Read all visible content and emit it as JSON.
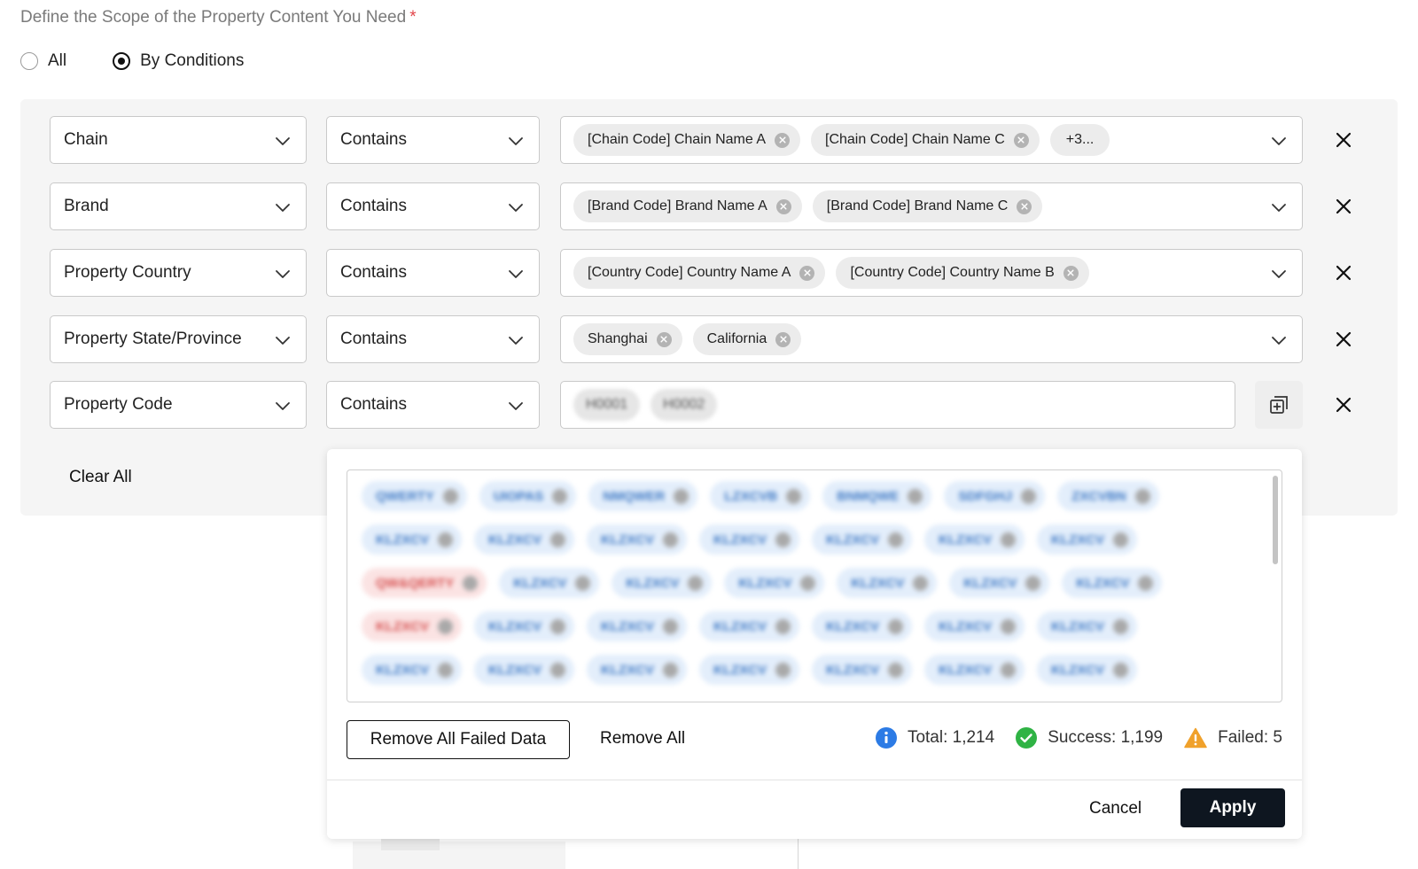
{
  "scope": {
    "title": "Define the Scope of the Property Content You Need",
    "required_mark": "*",
    "options": [
      {
        "label": "All",
        "selected": false
      },
      {
        "label": "By Conditions",
        "selected": true
      }
    ]
  },
  "conditions": [
    {
      "field": "Chain",
      "operator": "Contains",
      "values": [
        "[Chain Code] Chain Name A",
        "[Chain Code] Chain Name C"
      ],
      "more": "+3..."
    },
    {
      "field": "Brand",
      "operator": "Contains",
      "values": [
        "[Brand Code] Brand Name A",
        "[Brand Code] Brand Name C"
      ]
    },
    {
      "field": "Property Country",
      "operator": "Contains",
      "values": [
        "[Country Code] Country Name A",
        "[Country Code] Country Name B"
      ]
    },
    {
      "field": "Property State/Province",
      "operator": "Contains",
      "values": [
        "Shanghai",
        "California"
      ]
    },
    {
      "field": "Property Code",
      "operator": "Contains",
      "values": [
        "H0001",
        "H0002"
      ]
    }
  ],
  "clear_all_label": "Clear All",
  "popup": {
    "chip_rows": [
      [
        {
          "text": "QWERTY",
          "status": "ok"
        },
        {
          "text": "UIOPAS",
          "status": "ok"
        },
        {
          "text": "NMQWER",
          "status": "ok"
        },
        {
          "text": "LZXCVB",
          "status": "ok"
        },
        {
          "text": "BNMQWE",
          "status": "ok"
        },
        {
          "text": "SDFGHJ",
          "status": "ok"
        },
        {
          "text": "ZXCVBN",
          "status": "ok"
        }
      ],
      [
        {
          "text": "KLZXCV",
          "status": "ok"
        },
        {
          "text": "KLZXCV",
          "status": "ok"
        },
        {
          "text": "KLZXCV",
          "status": "ok"
        },
        {
          "text": "KLZXCV",
          "status": "ok"
        },
        {
          "text": "KLZXCV",
          "status": "ok"
        },
        {
          "text": "KLZXCV",
          "status": "ok"
        },
        {
          "text": "KLZXCV",
          "status": "ok"
        }
      ],
      [
        {
          "text": "QW&QERTY",
          "status": "fail"
        },
        {
          "text": "KLZXCV",
          "status": "ok"
        },
        {
          "text": "KLZXCV",
          "status": "ok"
        },
        {
          "text": "KLZXCV",
          "status": "ok"
        },
        {
          "text": "KLZXCV",
          "status": "ok"
        },
        {
          "text": "KLZXCV",
          "status": "ok"
        },
        {
          "text": "KLZXCV",
          "status": "ok"
        }
      ],
      [
        {
          "text": "KLZXCV",
          "status": "fail"
        },
        {
          "text": "KLZXCV",
          "status": "ok"
        },
        {
          "text": "KLZXCV",
          "status": "ok"
        },
        {
          "text": "KLZXCV",
          "status": "ok"
        },
        {
          "text": "KLZXCV",
          "status": "ok"
        },
        {
          "text": "KLZXCV",
          "status": "ok"
        },
        {
          "text": "KLZXCV",
          "status": "ok"
        }
      ],
      [
        {
          "text": "KLZXCV",
          "status": "ok"
        },
        {
          "text": "KLZXCV",
          "status": "ok"
        },
        {
          "text": "KLZXCV",
          "status": "ok"
        },
        {
          "text": "KLZXCV",
          "status": "ok"
        },
        {
          "text": "KLZXCV",
          "status": "ok"
        },
        {
          "text": "KLZXCV",
          "status": "ok"
        },
        {
          "text": "KLZXCV",
          "status": "ok"
        }
      ]
    ],
    "remove_failed_label": "Remove All Failed Data",
    "remove_all_label": "Remove All",
    "stats": {
      "total": "Total: 1,214",
      "success": "Success: 1,199",
      "failed": "Failed: 5"
    },
    "cancel_label": "Cancel",
    "apply_label": "Apply"
  },
  "colors": {
    "accent_dark": "#0e1620",
    "info_blue": "#2c7be5",
    "success_green": "#2fb344",
    "warning_orange": "#f0a12b",
    "required_red": "#e2454a"
  },
  "icons": {
    "chevron": "chevron-down-icon",
    "remove_row": "close-icon",
    "tag_remove": "close-circle-icon",
    "paste": "paste-list-icon",
    "info": "info-icon",
    "success": "check-circle-icon",
    "warning": "warning-icon"
  }
}
